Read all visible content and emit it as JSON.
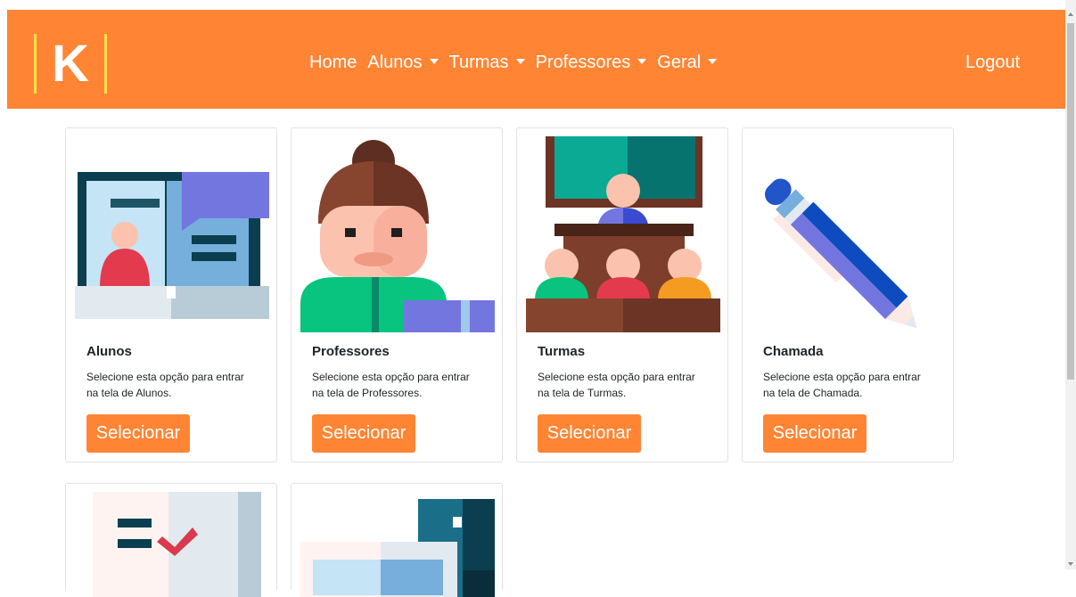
{
  "brand": {
    "logo_letter": "K"
  },
  "nav": {
    "items": [
      {
        "label": "Home",
        "dropdown": false
      },
      {
        "label": "Alunos",
        "dropdown": true
      },
      {
        "label": "Turmas",
        "dropdown": true
      },
      {
        "label": "Professores",
        "dropdown": true
      },
      {
        "label": "Geral",
        "dropdown": true
      }
    ],
    "logout": "Logout"
  },
  "cards": [
    {
      "title": "Alunos",
      "description": "Selecione esta opção para entrar na tela de Alunos.",
      "button": "Selecionar",
      "icon": "student-id-card-icon"
    },
    {
      "title": "Professores",
      "description": "Selecione esta opção para entrar na tela de Professores.",
      "button": "Selecionar",
      "icon": "teacher-icon"
    },
    {
      "title": "Turmas",
      "description": "Selecione esta opção para entrar na tela de Turmas.",
      "button": "Selecionar",
      "icon": "classroom-icon"
    },
    {
      "title": "Chamada",
      "description": "Selecione esta opção para entrar na tela de Chamada.",
      "button": "Selecionar",
      "icon": "pen-icon"
    }
  ],
  "partial_cards": [
    {
      "icon": "checklist-icon"
    },
    {
      "icon": "documents-icon"
    }
  ],
  "colors": {
    "navbar": "#ff8534",
    "button": "#ff8534",
    "logo_bars": "#ffe04a"
  }
}
